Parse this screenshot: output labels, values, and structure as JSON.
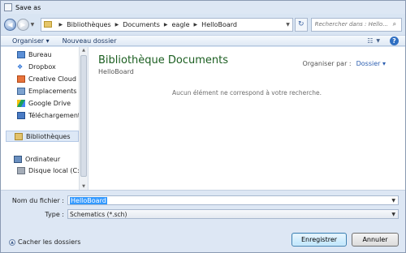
{
  "window": {
    "title": "Save as"
  },
  "address": {
    "crumbs": [
      "Bibliothèques",
      "Documents",
      "eagle",
      "HelloBoard"
    ]
  },
  "search": {
    "placeholder": "Rechercher dans : Hello..."
  },
  "toolbar": {
    "organize_label": "Organiser ▾",
    "new_folder_label": "Nouveau dossier"
  },
  "sidebar": {
    "items": [
      {
        "label": "Bureau",
        "icon": "desktop-icon"
      },
      {
        "label": "Dropbox",
        "icon": "dropbox-icon"
      },
      {
        "label": "Creative Cloud Fil",
        "icon": "creative-cloud-icon"
      },
      {
        "label": "Emplacements réc",
        "icon": "recent-places-icon"
      },
      {
        "label": "Google Drive",
        "icon": "google-drive-icon"
      },
      {
        "label": "Téléchargements",
        "icon": "downloads-icon"
      },
      {
        "label": "Bibliothèques",
        "icon": "libraries-icon",
        "selected": true
      },
      {
        "label": "Ordinateur",
        "icon": "computer-icon"
      },
      {
        "label": "Disque local (C:)",
        "icon": "hard-drive-icon"
      }
    ]
  },
  "content": {
    "title": "Bibliothèque Documents",
    "subtitle": "HelloBoard",
    "arrange_label": "Organiser par :",
    "arrange_value": "Dossier ▾",
    "empty_message": "Aucun élément ne correspond à votre recherche."
  },
  "form": {
    "filename_label": "Nom du fichier :",
    "filename_value": "HelloBoard",
    "type_label": "Type :",
    "type_value": "Schematics (*.sch)"
  },
  "footer": {
    "hide_folders_label": "Cacher les dossiers",
    "save_label": "Enregistrer",
    "cancel_label": "Annuler"
  },
  "colors": {
    "accent": "#3399ff",
    "library_title": "#1b5e20",
    "link": "#2a5db0"
  }
}
